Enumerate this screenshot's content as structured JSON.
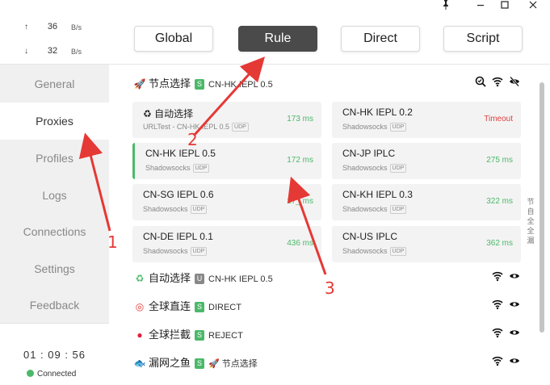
{
  "titlebar": {
    "pin_icon": "pin-icon",
    "minimize_icon": "minimize-icon",
    "maximize_icon": "maximize-icon",
    "close_icon": "close-icon"
  },
  "traffic": {
    "up": {
      "arrow": "↑",
      "value": "36",
      "unit": "B/s"
    },
    "down": {
      "arrow": "↓",
      "value": "32",
      "unit": "B/s"
    }
  },
  "nav": [
    {
      "label": "General",
      "active": false
    },
    {
      "label": "Proxies",
      "active": true
    },
    {
      "label": "Profiles",
      "active": false
    },
    {
      "label": "Logs",
      "active": false
    },
    {
      "label": "Connections",
      "active": false
    },
    {
      "label": "Settings",
      "active": false
    },
    {
      "label": "Feedback",
      "active": false
    }
  ],
  "footer": {
    "clock": "01 : 09 : 56",
    "status": "Connected",
    "status_color": "#4cb86a"
  },
  "modes": [
    {
      "label": "Global",
      "active": false
    },
    {
      "label": "Rule",
      "active": true
    },
    {
      "label": "Direct",
      "active": false
    },
    {
      "label": "Script",
      "active": false
    }
  ],
  "groups": {
    "g1": {
      "icon": "rocket-icon",
      "glyph": "🚀",
      "name": "节点选择",
      "badge": "S",
      "selected": "CN-HK IEPL 0.5"
    },
    "g2": {
      "icon": "recycle-icon",
      "glyph": "♻",
      "name": "自动选择",
      "badge": "U",
      "selected": "CN-HK IEPL 0.5"
    },
    "g3": {
      "icon": "target-icon",
      "glyph": "◎",
      "name": "全球直连",
      "badge": "S",
      "selected": "DIRECT"
    },
    "g4": {
      "icon": "stop-icon",
      "glyph": "●",
      "name": "全球拦截",
      "badge": "S",
      "selected": "REJECT"
    },
    "g5": {
      "icon": "fish-icon",
      "glyph": "🐟",
      "name": "漏网之鱼",
      "badge": "S",
      "selected_icon": "🚀",
      "selected": "节点选择"
    }
  },
  "proxies": [
    {
      "name": "♻ 自动选择",
      "sub": "URLTest - CN-HK IEPL 0.5",
      "udp": "UDP",
      "delay": "173 ms",
      "timeout": false,
      "selected": false
    },
    {
      "name": "CN-HK IEPL 0.2",
      "sub": "Shadowsocks",
      "udp": "UDP",
      "delay": "Timeout",
      "timeout": true,
      "selected": false
    },
    {
      "name": "CN-HK IEPL 0.5",
      "sub": "Shadowsocks",
      "udp": "UDP",
      "delay": "172 ms",
      "timeout": false,
      "selected": true
    },
    {
      "name": "CN-JP IPLC",
      "sub": "Shadowsocks",
      "udp": "UDP",
      "delay": "275 ms",
      "timeout": false,
      "selected": false
    },
    {
      "name": "CN-SG IEPL 0.6",
      "sub": "Shadowsocks",
      "udp": "UDP",
      "delay": "27_ ms",
      "timeout": false,
      "selected": false
    },
    {
      "name": "CN-KH IEPL 0.3",
      "sub": "Shadowsocks",
      "udp": "UDP",
      "delay": "322 ms",
      "timeout": false,
      "selected": false
    },
    {
      "name": "CN-DE IEPL 0.1",
      "sub": "Shadowsocks",
      "udp": "UDP",
      "delay": "436 ms",
      "timeout": false,
      "selected": false
    },
    {
      "name": "CN-US IPLC",
      "sub": "Shadowsocks",
      "udp": "UDP",
      "delay": "362 ms",
      "timeout": false,
      "selected": false
    }
  ],
  "side_hint": [
    "节",
    "自",
    "全",
    "全",
    "漏"
  ],
  "annotations": {
    "n1": "1",
    "n2": "2",
    "n3": "3",
    "color": "#e53935"
  },
  "colors": {
    "accent_green": "#4cb86a",
    "timeout_red": "#e04040",
    "active_mode_bg": "#4a4a4a"
  }
}
